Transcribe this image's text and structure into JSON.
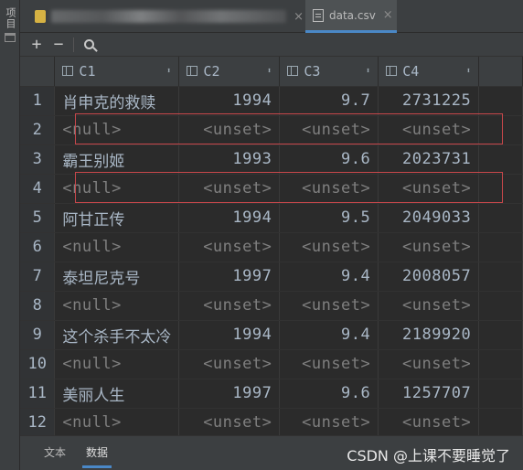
{
  "sidebar": {
    "project_tab_label": "项目"
  },
  "tabs": [
    {
      "label": "",
      "icon": "python-file-icon"
    },
    {
      "label": "data.csv",
      "icon": "csv-file-icon",
      "close": "×"
    }
  ],
  "toolbar": {
    "add": "+",
    "remove": "−",
    "search_icon": "search-icon"
  },
  "table": {
    "columns": [
      "C1",
      "C2",
      "C3",
      "C4"
    ],
    "rows": [
      {
        "n": "1",
        "c1": "肖申克的救赎",
        "c2": "1994",
        "c3": "9.7",
        "c4": "2731225"
      },
      {
        "n": "2",
        "c1": "<null>",
        "c2": "<unset>",
        "c3": "<unset>",
        "c4": "<unset>"
      },
      {
        "n": "3",
        "c1": "霸王别姬",
        "c2": "1993",
        "c3": "9.6",
        "c4": "2023731"
      },
      {
        "n": "4",
        "c1": "<null>",
        "c2": "<unset>",
        "c3": "<unset>",
        "c4": "<unset>"
      },
      {
        "n": "5",
        "c1": "阿甘正传",
        "c2": "1994",
        "c3": "9.5",
        "c4": "2049033"
      },
      {
        "n": "6",
        "c1": "<null>",
        "c2": "<unset>",
        "c3": "<unset>",
        "c4": "<unset>"
      },
      {
        "n": "7",
        "c1": "泰坦尼克号",
        "c2": "1997",
        "c3": "9.4",
        "c4": "2008057"
      },
      {
        "n": "8",
        "c1": "<null>",
        "c2": "<unset>",
        "c3": "<unset>",
        "c4": "<unset>"
      },
      {
        "n": "9",
        "c1": "这个杀手不太冷",
        "c2": "1994",
        "c3": "9.4",
        "c4": "2189920"
      },
      {
        "n": "10",
        "c1": "<null>",
        "c2": "<unset>",
        "c3": "<unset>",
        "c4": "<unset>"
      },
      {
        "n": "11",
        "c1": "美丽人生",
        "c2": "1997",
        "c3": "9.6",
        "c4": "1257707"
      },
      {
        "n": "12",
        "c1": "<null>",
        "c2": "<unset>",
        "c3": "<unset>",
        "c4": "<unset>"
      }
    ],
    "highlighted_rows": [
      "2",
      "4"
    ]
  },
  "bottom_tabs": [
    {
      "label": "文本",
      "active": false
    },
    {
      "label": "数据",
      "active": true
    }
  ],
  "watermark": "CSDN @上课不要睡觉了",
  "colors": {
    "accent": "#4a88c7",
    "highlight_box": "#c8474b",
    "null_text": "#7f7f7f"
  }
}
